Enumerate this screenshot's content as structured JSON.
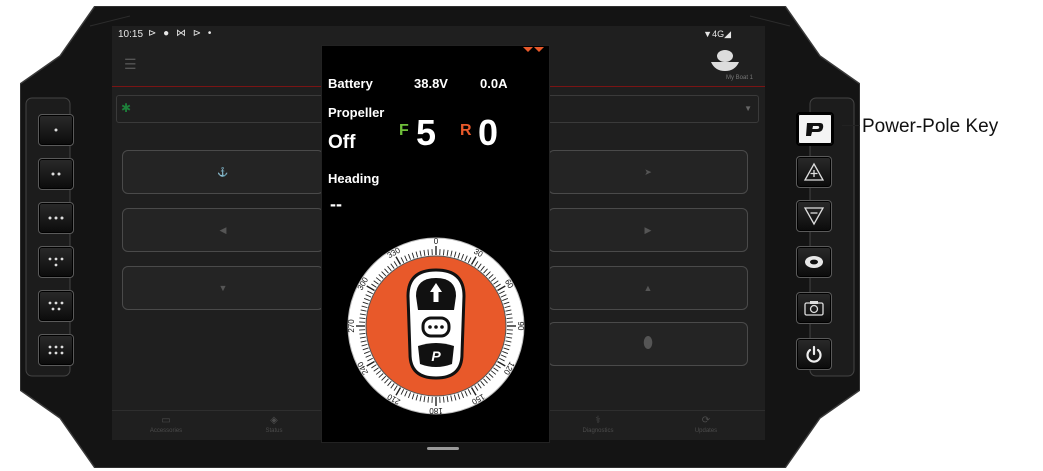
{
  "statusbar": {
    "time": "10:15",
    "icons": "⊳ ● ⋈ ⊳ •",
    "signal": "▼4G◢"
  },
  "header": {
    "boat_name": "My Boat 1"
  },
  "overlay": {
    "battery_label": "Battery",
    "battery_voltage": "38.8V",
    "battery_current": "0.0A",
    "propeller_label": "Propeller",
    "propeller_state": "Off",
    "forward_letter": "F",
    "forward_value": "5",
    "reverse_letter": "R",
    "reverse_value": "0",
    "heading_label": "Heading",
    "heading_value": "--",
    "compass_ticks": [
      "0",
      "30",
      "60",
      "90",
      "120",
      "150",
      "180",
      "210",
      "240",
      "270",
      "300",
      "330"
    ]
  },
  "nav": {
    "items": [
      {
        "label": "Accessories",
        "icon": "accessories-icon"
      },
      {
        "label": "Status",
        "icon": "status-icon"
      },
      {
        "label": "Diagnostics",
        "icon": "diagnostics-icon"
      },
      {
        "label": "Updates",
        "icon": "updates-icon"
      }
    ]
  },
  "callout": {
    "label": "Power-Pole Key"
  },
  "colors": {
    "accent": "#e8592a",
    "forward_green": "#6fbf3a",
    "reverse_orange": "#e8592a",
    "bezel": "#141414"
  }
}
